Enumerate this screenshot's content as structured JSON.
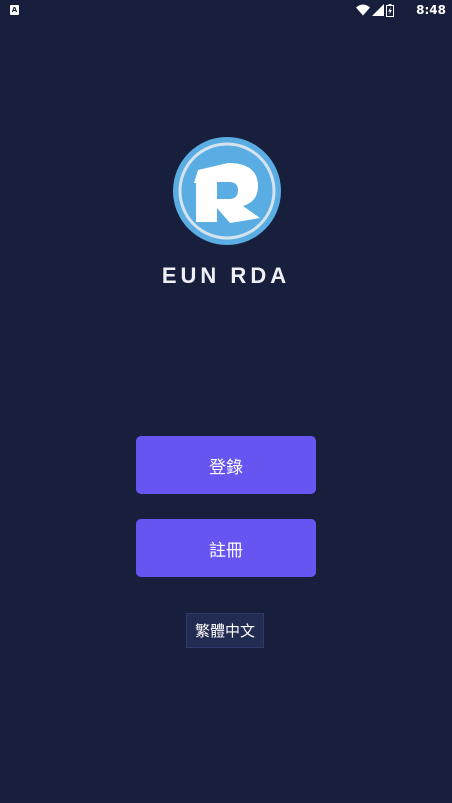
{
  "status_bar": {
    "time": "8:48",
    "app_icon_letter": "A",
    "icons": [
      "wifi-icon",
      "signal-icon",
      "battery-icon"
    ]
  },
  "brand": {
    "logo_icon": "r-logo-icon",
    "name": "EUN RDA"
  },
  "actions": {
    "login_label": "登錄",
    "register_label": "註冊"
  },
  "language": {
    "label": "繁體中文"
  },
  "colors": {
    "background": "#181f3d",
    "button": "#6655f0",
    "logo_blue": "#5aade3"
  }
}
